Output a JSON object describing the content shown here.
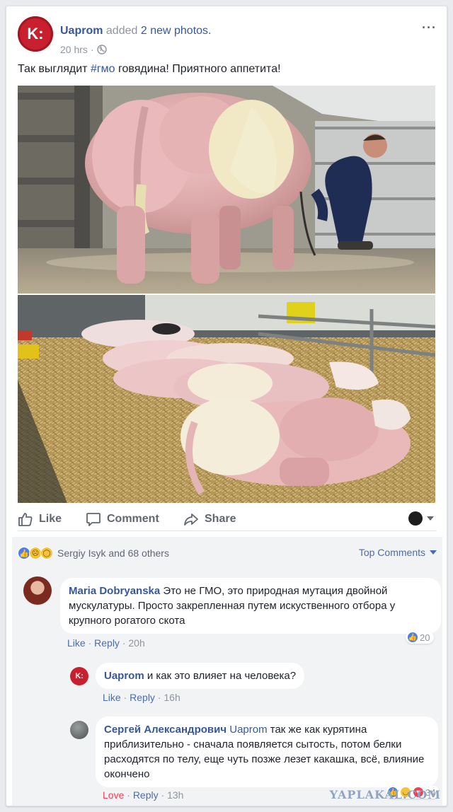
{
  "post": {
    "page_name": "Uaprom",
    "action_text": "added",
    "action_link": "2 new photos.",
    "time": "20 hrs",
    "separator": "·",
    "avatar_letter": "K:",
    "text_before": "Так выглядит ",
    "hashtag": "#гмо",
    "text_after": " говядина! Приятного аппетита!",
    "more": "···"
  },
  "actions": {
    "like": "Like",
    "comment": "Comment",
    "share": "Share"
  },
  "reactions": {
    "summary": "Sergiy Isyk and 68 others",
    "top_comments": "Top Comments"
  },
  "comments": [
    {
      "author": "Maria Dobryanska",
      "text": "Это не ГМО, это природная мутация двойной мускулатуры. Просто закрепленная путем искуственного отбора у крупного рогатого скота",
      "like_label": "Like",
      "reply_label": "Reply",
      "time": "20h",
      "sep": "·",
      "reaction_count": "20"
    },
    {
      "author": "Uaprom",
      "text": "и как это влияет на человека?",
      "like_label": "Like",
      "reply_label": "Reply",
      "time": "16h",
      "sep": "·",
      "avatar_letter": "K:"
    },
    {
      "author": "Сергей Александрович",
      "mention": "Uaprom",
      "text": "так же как курятина приблизительно - сначала появляется сытость, потом белки расходятся по телу, еще чуть позже лезет какашка, всё, влияние окончено",
      "like_label": "Love",
      "reply_label": "Reply",
      "time": "13h",
      "sep": "·",
      "reaction_count": "34"
    }
  ],
  "watermark": "YAPLAKAL.COM",
  "colors": {
    "link": "#365899",
    "meta": "#90949c",
    "love": "#f33e58",
    "page_avatar": "#c9202f",
    "comments_bg": "#f2f3f5"
  }
}
